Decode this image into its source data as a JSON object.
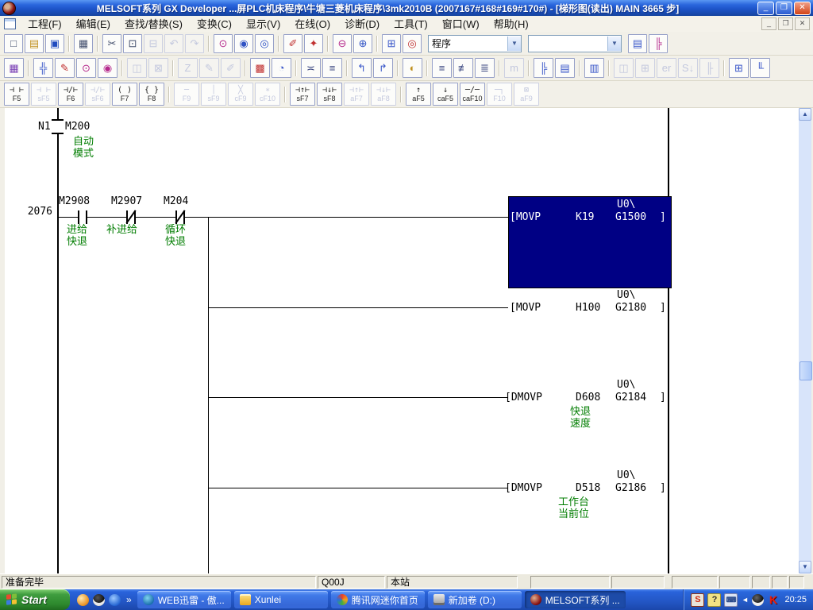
{
  "window": {
    "title": "MELSOFT系列 GX Developer ...屏PLC机床程序\\牛塘三菱机床程序\\3mk2010B   (2007167#168#169#170#) - [梯形图(读出)   MAIN   3665 步]",
    "minimize": "_",
    "maximize": "❐",
    "close": "✕",
    "mdi_minimize": "_",
    "mdi_restore": "❐",
    "mdi_close": "✕"
  },
  "menu": {
    "items": [
      "工程(F)",
      "编辑(E)",
      "查找/替换(S)",
      "变换(C)",
      "显示(V)",
      "在线(O)",
      "诊断(D)",
      "工具(T)",
      "窗口(W)",
      "帮助(H)"
    ]
  },
  "toolbar1": {
    "buttons": [
      {
        "name": "new-button",
        "g": "□",
        "c": "#44506e"
      },
      {
        "name": "open-button",
        "g": "▤",
        "c": "#c09020"
      },
      {
        "name": "save-button",
        "g": "▣",
        "c": "#204bbf"
      },
      {
        "sep": true
      },
      {
        "name": "print-button",
        "g": "▦",
        "c": "#44506e"
      },
      {
        "sep": true
      },
      {
        "name": "cut-button",
        "g": "✂",
        "c": "#44506e"
      },
      {
        "name": "copy-button",
        "g": "⊡",
        "c": "#44506e"
      },
      {
        "name": "paste-button",
        "g": "⊟",
        "enabled": false
      },
      {
        "name": "undo-button",
        "g": "↶",
        "enabled": false
      },
      {
        "name": "redo-button",
        "g": "↷",
        "enabled": false
      },
      {
        "sep": true
      },
      {
        "name": "find-button",
        "g": "⊙",
        "c": "#b5298c"
      },
      {
        "name": "find-device-button",
        "g": "◉",
        "c": "#2f52c4"
      },
      {
        "name": "find-instruction-button",
        "g": "◎",
        "c": "#2f52c4"
      },
      {
        "sep": true
      },
      {
        "name": "device-test-button",
        "g": "✐",
        "c": "#c03030"
      },
      {
        "name": "forced-onoff-button",
        "g": "✦",
        "c": "#c03030"
      },
      {
        "sep": true
      },
      {
        "name": "zoom-out-button",
        "g": "⊖",
        "c": "#b5298c"
      },
      {
        "name": "zoom-in-button",
        "g": "⊕",
        "c": "#2f52c4"
      },
      {
        "sep": true
      },
      {
        "name": "window-switch-button",
        "g": "⊞",
        "c": "#3a57c9"
      },
      {
        "name": "cross-reference-button",
        "g": "◎",
        "c": "#c03030"
      }
    ],
    "program_combo": "程序",
    "find_combo": "",
    "right_buttons": [
      {
        "name": "doc-preview-button",
        "g": "▤",
        "c": "#3a57c9"
      },
      {
        "name": "parameter-tree-button",
        "g": "╠",
        "c": "#b5298c"
      }
    ]
  },
  "toolbar2": {
    "buttons": [
      {
        "name": "ladder-monitor-button",
        "g": "▦",
        "c": "#7a3fb5"
      },
      {
        "sep": true
      },
      {
        "name": "symbol-list-button",
        "g": "╬",
        "c": "#3a57c9"
      },
      {
        "name": "symbol-edit-button",
        "g": "✎",
        "c": "#c03030"
      },
      {
        "name": "device-find-button",
        "g": "⊙",
        "c": "#b5298c"
      },
      {
        "name": "device-find-edit-button",
        "g": "◉",
        "c": "#b5298c"
      },
      {
        "sep": true
      },
      {
        "name": "trace-button",
        "g": "◫",
        "enabled": false
      },
      {
        "name": "trace-stop-button",
        "g": "⊠",
        "enabled": false
      },
      {
        "sep": true
      },
      {
        "name": "partial-convert-button",
        "g": "Z",
        "enabled": false
      },
      {
        "name": "partial-edit-button",
        "g": "✎",
        "enabled": false
      },
      {
        "name": "partial-delete-button",
        "g": "✐",
        "enabled": false
      },
      {
        "sep": true
      },
      {
        "name": "device-memory-button",
        "g": "▩",
        "c": "#c03030"
      },
      {
        "name": "entry-monitor-button",
        "g": "◔",
        "c": "#3a57c9"
      },
      {
        "sep": true
      },
      {
        "name": "monitor-start-button",
        "g": "≍",
        "c": "#39457f"
      },
      {
        "name": "monitor-stop-button",
        "g": "≡",
        "c": "#39457f"
      },
      {
        "sep": true
      },
      {
        "name": "jump-source-button",
        "g": "↰",
        "c": "#3a57c9"
      },
      {
        "name": "jump-dest-button",
        "g": "↱",
        "c": "#3a57c9"
      },
      {
        "sep": true
      },
      {
        "name": "monitor-condition-button",
        "g": "◐",
        "c": "#c09020"
      },
      {
        "sep": true
      },
      {
        "name": "comment-display-button",
        "g": "≡",
        "c": "#39457f"
      },
      {
        "name": "statement-display-button",
        "g": "≢",
        "c": "#39457f"
      },
      {
        "name": "note-display-button",
        "g": "≣",
        "c": "#39457f"
      },
      {
        "sep": true
      },
      {
        "name": "macro-button",
        "g": "m",
        "enabled": false
      },
      {
        "sep": true
      },
      {
        "name": "project-list-button",
        "g": "╠",
        "c": "#3a57c9"
      },
      {
        "name": "comment-edit-button",
        "g": "▤",
        "c": "#3a57c9"
      },
      {
        "sep": true
      },
      {
        "name": "doc-setting-button",
        "g": "▥",
        "c": "#3a57c9"
      },
      {
        "sep": true
      },
      {
        "name": "online-change-button",
        "g": "◫",
        "enabled": false
      },
      {
        "name": "multi-monitor-button",
        "g": "⊞",
        "enabled": false
      },
      {
        "name": "error-jump-button",
        "g": "er",
        "enabled": false
      },
      {
        "name": "step-execute-button",
        "g": "S↓",
        "enabled": false
      },
      {
        "name": "block-select-button",
        "g": "╟",
        "enabled": false
      },
      {
        "sep": true
      },
      {
        "name": "window-split-button",
        "g": "⊞",
        "c": "#3a57c9"
      },
      {
        "name": "list-down-button",
        "g": "╙",
        "c": "#3a57c9"
      }
    ]
  },
  "ladder_toolbar": {
    "buttons": [
      {
        "name": "open-contact-button",
        "sym": "⊣ ⊢",
        "key": "F5"
      },
      {
        "name": "parallel-open-contact-button",
        "sym": "⊣ ⊢",
        "key": "sF5",
        "enabled": false
      },
      {
        "name": "closed-contact-button",
        "sym": "⊣/⊢",
        "key": "F6"
      },
      {
        "name": "parallel-closed-contact-button",
        "sym": "⊣/⊢",
        "key": "sF6",
        "enabled": false
      },
      {
        "name": "coil-button",
        "sym": "( )",
        "key": "F7"
      },
      {
        "name": "application-instruction-button",
        "sym": "{ }",
        "key": "F8"
      },
      {
        "sep": true
      },
      {
        "name": "horizontal-line-button",
        "sym": "─",
        "key": "F9",
        "enabled": false
      },
      {
        "name": "vertical-line-button",
        "sym": "│",
        "key": "sF9",
        "enabled": false
      },
      {
        "name": "delete-horizontal-line-button",
        "sym": "╳",
        "key": "cF9",
        "enabled": false
      },
      {
        "name": "delete-vertical-line-button",
        "sym": "∗",
        "key": "cF10",
        "enabled": false
      },
      {
        "sep": true
      },
      {
        "name": "rising-pulse-button",
        "sym": "⊣↑⊢",
        "key": "sF7"
      },
      {
        "name": "falling-pulse-button",
        "sym": "⊣↓⊢",
        "key": "sF8"
      },
      {
        "name": "parallel-rising-pulse-button",
        "sym": "⊣↑⊢",
        "key": "aF7",
        "enabled": false
      },
      {
        "name": "parallel-falling-pulse-button",
        "sym": "⊣↓⊢",
        "key": "aF8",
        "enabled": false
      },
      {
        "sep": true
      },
      {
        "name": "rising-pulse-op-button",
        "sym": "↑",
        "key": "aF5"
      },
      {
        "name": "falling-pulse-op-button",
        "sym": "↓",
        "key": "caF5"
      },
      {
        "name": "invert-operation-button",
        "sym": "─∕─",
        "key": "caF10"
      },
      {
        "name": "horizontal-line-f10-button",
        "sym": "─┐",
        "key": "F10",
        "enabled": false
      },
      {
        "name": "delete-box-button",
        "sym": "⊠",
        "key": "aF9",
        "enabled": false
      }
    ]
  },
  "ladder": {
    "nesting": "N1",
    "mc_device": "M200",
    "mc_comment": [
      "自动",
      "模式"
    ],
    "step_no": "2076",
    "contact1": {
      "device": "M2908",
      "comment": [
        "进给",
        "快退"
      ]
    },
    "contact2": {
      "device": "M2907",
      "comment": [
        "补进给"
      ]
    },
    "contact3": {
      "device": "M204",
      "comment": [
        "循环",
        "快退"
      ]
    },
    "inst1": {
      "op": "[MOVP",
      "src": "K19",
      "dp": "U0\\",
      "dev": "G1500",
      "close": "]"
    },
    "inst2": {
      "op": "[MOVP",
      "src": "H100",
      "dp": "U0\\",
      "dev": "G2180",
      "close": "]"
    },
    "inst3": {
      "op": "[DMOVP",
      "src": "D608",
      "dp": "U0\\",
      "dev": "G2184",
      "close": "]",
      "comment": [
        "快退",
        "速度"
      ]
    },
    "inst4": {
      "op": "[DMOVP",
      "src": "D518",
      "dp": "U0\\",
      "dev": "G2186",
      "close": "]",
      "comment": [
        "工作台",
        "当前位"
      ]
    }
  },
  "scrollbar": {
    "up": "▲",
    "down": "▼"
  },
  "status_bar": {
    "ready": "准备完毕",
    "cpu_type": "Q00J",
    "station": "本站"
  },
  "taskbar": {
    "start_label": "Start",
    "overflow": "»",
    "quick_launch": [
      {
        "name": "quicklaunch-bird-icon",
        "cls": "bird"
      },
      {
        "name": "quicklaunch-qq-icon",
        "cls": "qq"
      },
      {
        "name": "quicklaunch-media-player-icon",
        "cls": "media"
      }
    ],
    "tasks": [
      {
        "name": "taskbar-button-web-xunlei",
        "label": "WEB迅雷 - 傲...",
        "cls": "web"
      },
      {
        "name": "taskbar-button-xunlei-folder",
        "label": "Xunlei",
        "cls": "xunlei"
      },
      {
        "name": "taskbar-button-tencent-home",
        "label": "腾讯网迷你首页",
        "cls": "tencent"
      },
      {
        "name": "taskbar-button-volume-d",
        "label": "新加卷 (D:)",
        "cls": "drive"
      },
      {
        "name": "taskbar-button-melsoft",
        "label": "MELSOFT系列 ...",
        "cls": "melsoft",
        "active": true
      }
    ],
    "tray": {
      "sogou": "S",
      "ime_help": "?",
      "collapse": "◄",
      "kingsoft": "K",
      "time": "20:25"
    }
  }
}
